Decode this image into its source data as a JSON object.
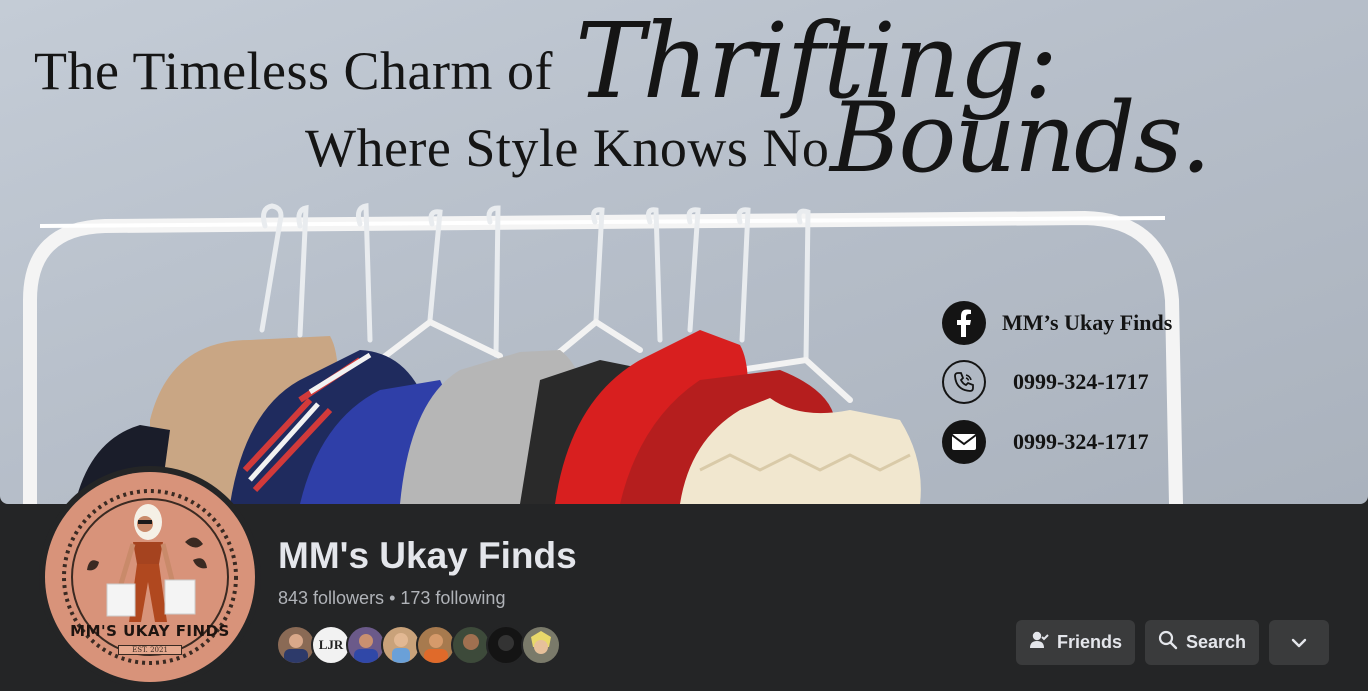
{
  "cover": {
    "headline_line1": "The Timeless Charm of",
    "headline_script1": "Thrifting:",
    "headline_line2": "Where Style Knows No",
    "headline_script2": "Bounds.",
    "contacts": [
      {
        "icon": "facebook-icon",
        "text": "MM’s  Ukay Finds"
      },
      {
        "icon": "phone-icon",
        "text": "0999-324-1717"
      },
      {
        "icon": "mail-icon",
        "text": "0999-324-1717"
      }
    ]
  },
  "profile": {
    "logo_text": "MM'S UKAY FINDS",
    "logo_est": "EST. 2021",
    "name": "MM's Ukay Finds",
    "followers": "843 followers",
    "separator": "•",
    "following": "173 following"
  },
  "friend_avatars": [
    {
      "initials": "",
      "color": "#8a6a55"
    },
    {
      "initials": "LJR",
      "color": "#f2f2f2"
    },
    {
      "initials": "",
      "color": "#6b5a8a"
    },
    {
      "initials": "",
      "color": "#c9a27a"
    },
    {
      "initials": "",
      "color": "#a77a4e"
    },
    {
      "initials": "",
      "color": "#3d4a3a"
    },
    {
      "initials": "",
      "color": "#141414"
    },
    {
      "initials": "",
      "color": "#7a7a6a"
    }
  ],
  "actions": {
    "friends_label": "Friends",
    "search_label": "Search",
    "more_icon": "chevron-down-icon"
  },
  "colors": {
    "background": "#242526",
    "button": "#3a3b3c",
    "text_primary": "#e4e6eb",
    "text_secondary": "#b0b3b8"
  }
}
